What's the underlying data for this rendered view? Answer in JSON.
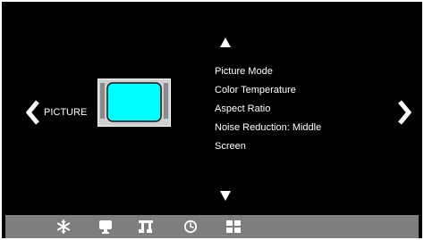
{
  "osd": {
    "category": "PICTURE",
    "category_icon": "picture-monitor-icon",
    "menu_items": [
      "Picture Mode",
      "Color Temperature",
      "Aspect Ratio",
      "Noise Reduction: Middle",
      "Screen"
    ]
  },
  "bottom_bar": {
    "icons": [
      "snowflake-icon",
      "monitor-icon",
      "music-icon",
      "clock-icon",
      "apps-grid-icon"
    ]
  },
  "colors": {
    "background": "#000000",
    "text": "#ffffff",
    "bottom_bar": "#7e7e7e",
    "screen_fill": "#00ffff",
    "monitor_frame": "#cfcfcf"
  }
}
